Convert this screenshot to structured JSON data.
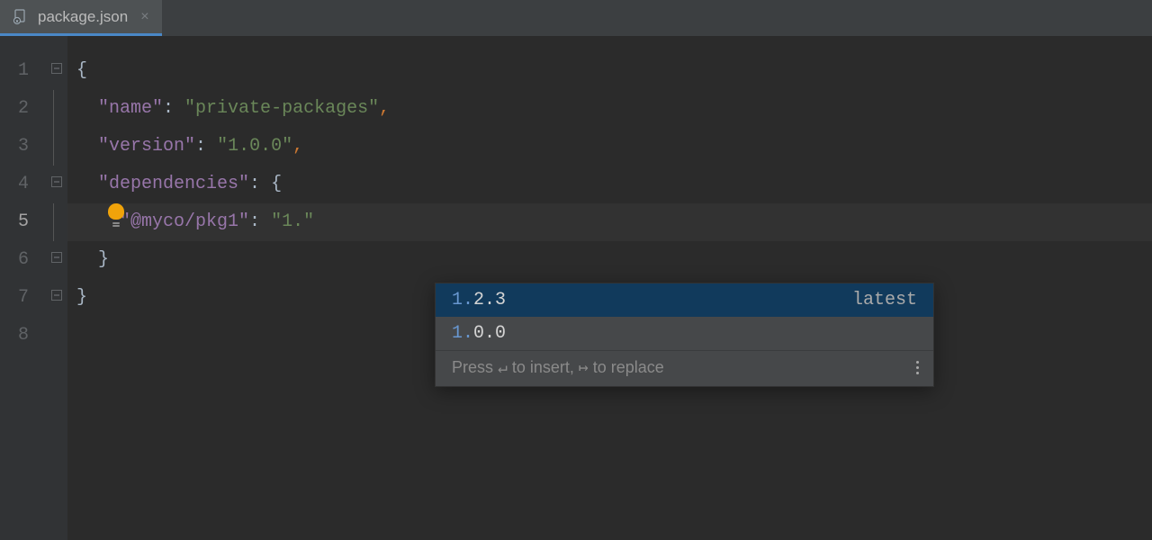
{
  "tab": {
    "label": "package.json",
    "close": "×"
  },
  "gutter": {
    "lines": [
      "1",
      "2",
      "3",
      "4",
      "5",
      "6",
      "7",
      "8"
    ],
    "currentLine": 5
  },
  "code": {
    "line1": {
      "brace": "{"
    },
    "line2": {
      "key": "\"name\"",
      "colon": ": ",
      "value": "\"private-packages\"",
      "comma": ","
    },
    "line3": {
      "key": "\"version\"",
      "colon": ": ",
      "value": "\"1.0.0\"",
      "comma": ","
    },
    "line4": {
      "key": "\"dependencies\"",
      "colon": ": ",
      "brace": "{"
    },
    "line5": {
      "key": "\"@myco/pkg1\"",
      "colon": ": ",
      "value": "\"1.\""
    },
    "line6": {
      "brace": "}"
    },
    "line7": {
      "brace": "}"
    }
  },
  "completion": {
    "items": [
      {
        "match": "1.",
        "rest": "2.3",
        "tag": "latest",
        "selected": true
      },
      {
        "match": "1.",
        "rest": "0.0",
        "tag": "",
        "selected": false
      }
    ],
    "footer": {
      "press": "Press ",
      "enterSym": "↵",
      "insert": " to insert, ",
      "tabSym": "↦",
      "replace": " to replace"
    }
  }
}
